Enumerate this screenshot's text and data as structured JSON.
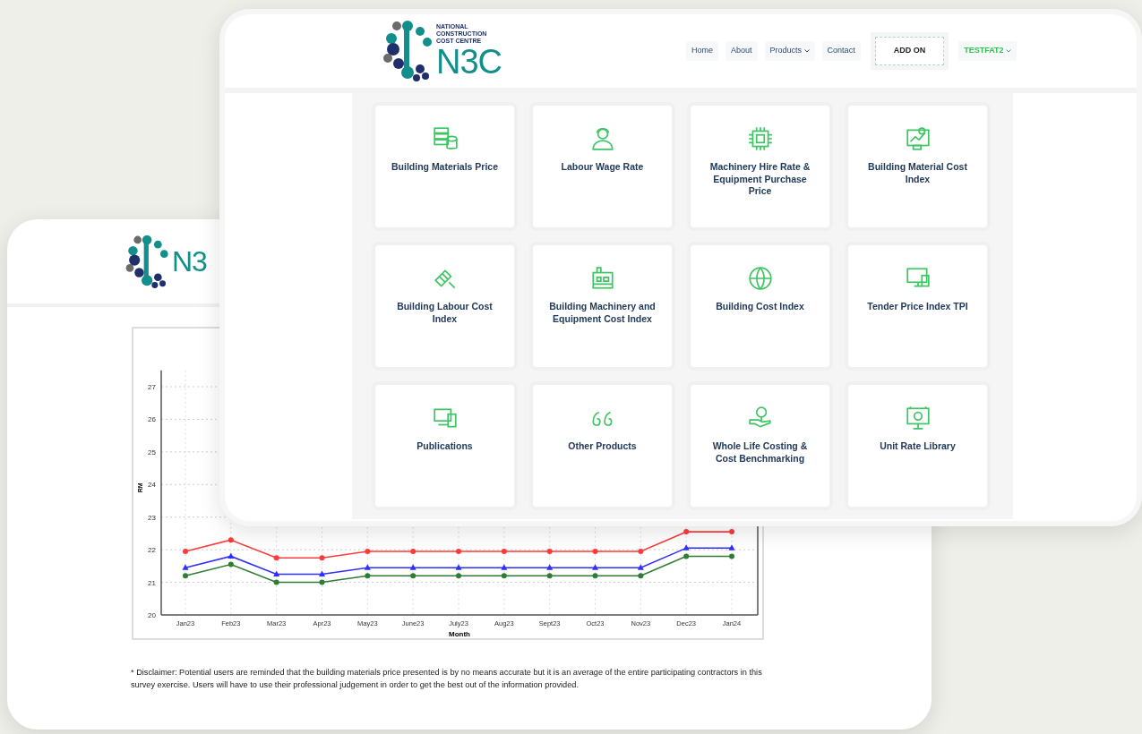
{
  "back_window": {
    "logo": {
      "mark": "N3"
    },
    "chart": {
      "chart_data": {
        "type": "line",
        "xlabel": "Month",
        "ylabel": "RM",
        "categories": [
          "Jan23",
          "Feb23",
          "Mar23",
          "Apr23",
          "May23",
          "June23",
          "July23",
          "Aug23",
          "Sept23",
          "Oct23",
          "Nov23",
          "Dec23",
          "Jan24"
        ],
        "ylim": [
          20,
          27.5
        ],
        "grid": true,
        "yticks": [
          20,
          21,
          22,
          23,
          24,
          25,
          26,
          27
        ],
        "series": [
          {
            "color": "#ff3b3b",
            "marker": "circle",
            "values": [
              21.95,
              22.3,
              21.75,
              21.75,
              21.95,
              21.95,
              21.95,
              21.95,
              21.95,
              21.95,
              21.95,
              22.55,
              22.55
            ]
          },
          {
            "color": "#2f2fff",
            "marker": "triangle",
            "values": [
              21.45,
              21.8,
              21.25,
              21.25,
              21.45,
              21.45,
              21.45,
              21.45,
              21.45,
              21.45,
              21.45,
              22.05,
              22.05
            ]
          },
          {
            "color": "#2e7d32",
            "marker": "circle",
            "values": [
              21.2,
              21.55,
              21.0,
              21.0,
              21.2,
              21.2,
              21.2,
              21.2,
              21.2,
              21.2,
              21.2,
              21.8,
              21.8
            ]
          }
        ]
      }
    },
    "disclaimer": "* Disclaimer: Potential users are reminded that the building materials price presented is by no means accurate but it is an average of the entire participating contractors in this survey exercise. Users will have to use their professional judgement in order to get the best out of the information provided."
  },
  "front_window": {
    "logo": {
      "mark": "N3C",
      "subtitle": [
        "NATIONAL",
        "CONSTRUCTION",
        "COST CENTRE"
      ]
    },
    "nav": [
      {
        "label": "Home",
        "kind": "link"
      },
      {
        "label": "About",
        "kind": "link"
      },
      {
        "label": "Products",
        "kind": "dropdown"
      },
      {
        "label": "Contact",
        "kind": "link"
      },
      {
        "label": "ADD ON",
        "kind": "button"
      },
      {
        "label": "TESTFAT2",
        "kind": "user"
      }
    ],
    "products": [
      {
        "label": "Building Materials Price"
      },
      {
        "label": "Labour Wage Rate"
      },
      {
        "label": "Machinery Hire Rate & Equipment Purchase Price"
      },
      {
        "label": "Building Material Cost Index"
      },
      {
        "label": "Building Labour Cost Index"
      },
      {
        "label": "Building Machinery and Equipment Cost Index"
      },
      {
        "label": "Building Cost Index"
      },
      {
        "label": "Tender Price Index TPI"
      },
      {
        "label": "Publications"
      },
      {
        "label": "Other Products"
      },
      {
        "label": "Whole Life Costing & Cost Benchmarking"
      },
      {
        "label": "Unit Rate Library"
      }
    ]
  }
}
